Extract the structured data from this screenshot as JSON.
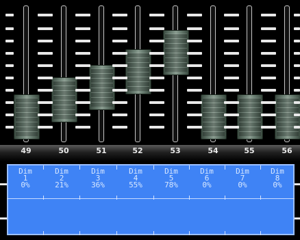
{
  "channel_numbers": [
    "49",
    "50",
    "51",
    "52",
    "53",
    "54",
    "55",
    "56"
  ],
  "dimmers": [
    {
      "name": "Dim",
      "num": "1",
      "value": "0%",
      "level": 0.0
    },
    {
      "name": "Dim",
      "num": "2",
      "value": "21%",
      "level": 0.21
    },
    {
      "name": "Dim",
      "num": "3",
      "value": "36%",
      "level": 0.36
    },
    {
      "name": "Dim",
      "num": "4",
      "value": "55%",
      "level": 0.55
    },
    {
      "name": "Dim",
      "num": "5",
      "value": "78%",
      "level": 0.78
    },
    {
      "name": "Dim",
      "num": "6",
      "value": "0%",
      "level": 0.0
    },
    {
      "name": "Dim",
      "num": "7",
      "value": "0%",
      "level": 0.0
    },
    {
      "name": "Dim",
      "num": "8",
      "value": "0%",
      "level": 0.0
    }
  ],
  "colors": {
    "panel_blue": "#3f83f5",
    "panel_text": "#d8e8ff",
    "knob": "#6f8377"
  }
}
